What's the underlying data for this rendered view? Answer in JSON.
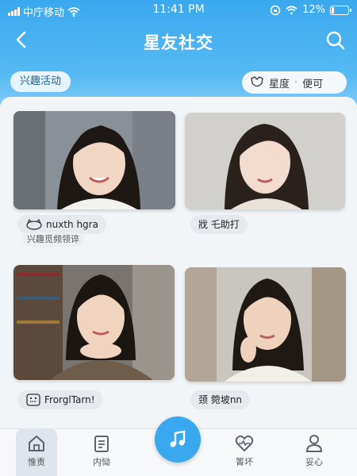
{
  "status_bar": {
    "carrier": "中庁移动",
    "time": "11:41 PM",
    "battery": "12%"
  },
  "nav": {
    "title": "星友社交",
    "back_icon": "chevron-left-icon",
    "search_icon": "search-icon"
  },
  "filters": {
    "tag_label": "兴趣活动",
    "right_left": "星度",
    "right_sep": "·",
    "right_right": "便可"
  },
  "cards": [
    {
      "name": "nuxth hgra",
      "sub": "兴趣觅频领谇",
      "icon": "face-icon"
    },
    {
      "name": "戕 乇助打"
    },
    {
      "name": "Frorgl‌Tarn!",
      "icon": "grid-face-icon"
    },
    {
      "name": "颈 箢坡nn"
    }
  ],
  "tabs": [
    {
      "label": "惟责",
      "icon": "home-icon"
    },
    {
      "label": "内恸",
      "icon": "clipboard-icon"
    },
    {
      "label": "",
      "icon": "music-note-icon"
    },
    {
      "label": "箐坏",
      "icon": "heart-pulse-icon"
    },
    {
      "label": "妥心",
      "icon": "user-icon"
    }
  ],
  "colors": {
    "accent": "#3aa8ee",
    "header_light": "#7cc9f6"
  }
}
